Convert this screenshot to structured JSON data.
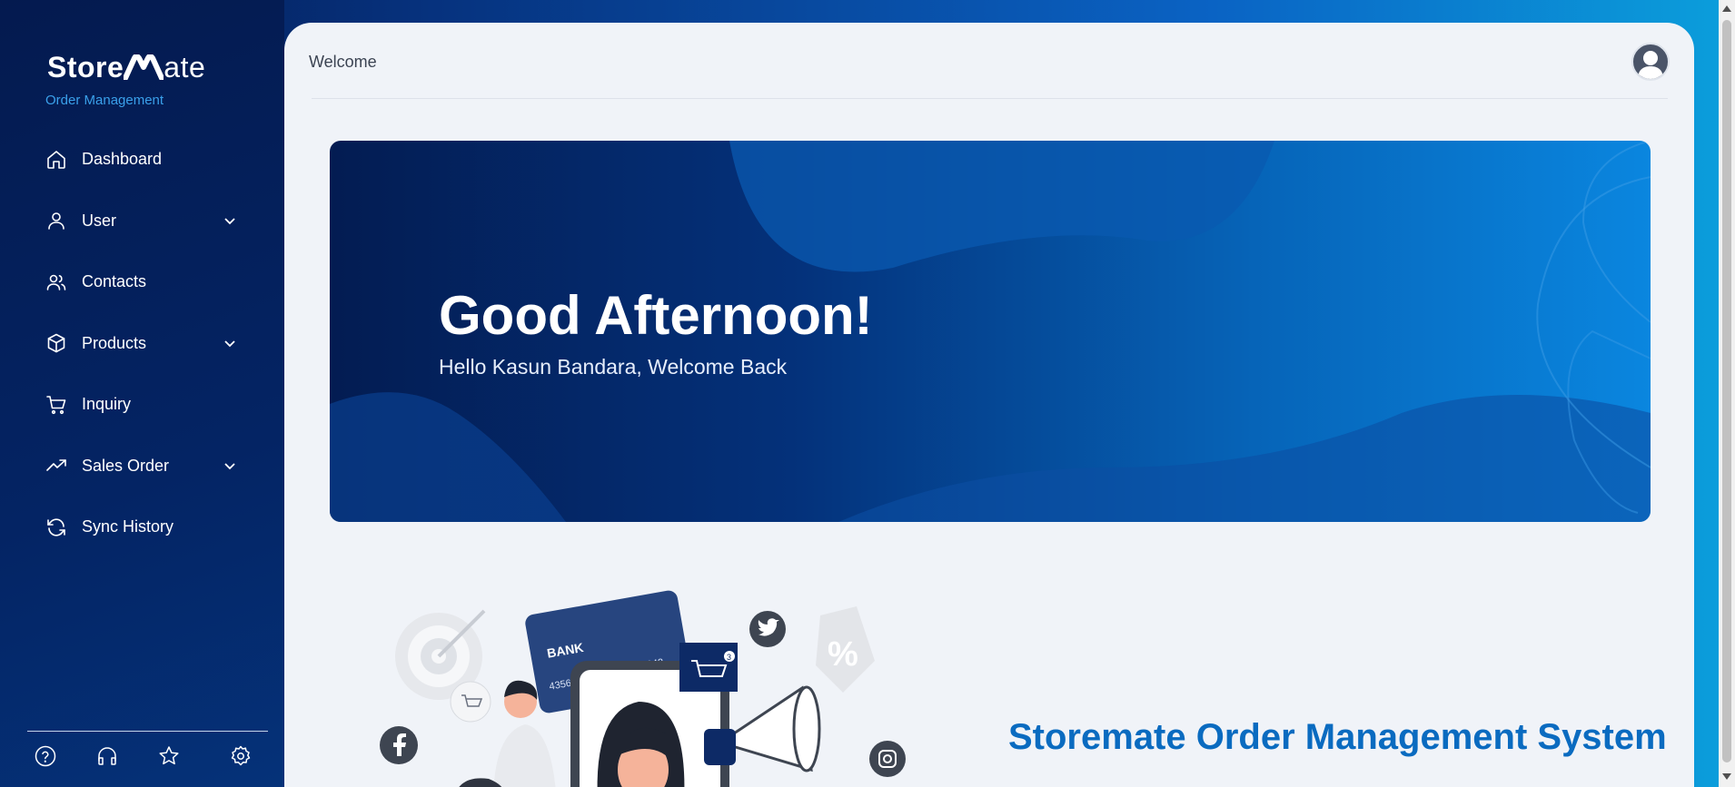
{
  "sidebar": {
    "logo_bold": "Store",
    "logo_light": "ate",
    "logo_subtitle": "Order Management",
    "items": [
      {
        "label": "Dashboard",
        "icon": "home-icon"
      },
      {
        "label": "User",
        "icon": "user-icon",
        "expandable": true
      },
      {
        "label": "Contacts",
        "icon": "users-icon"
      },
      {
        "label": "Products",
        "icon": "box-icon",
        "expandable": true
      },
      {
        "label": "Inquiry",
        "icon": "cart-icon"
      },
      {
        "label": "Sales Order",
        "icon": "trending-up-icon",
        "expandable": true
      },
      {
        "label": "Sync History",
        "icon": "refresh-icon"
      }
    ],
    "bottom_icons": [
      "help-icon",
      "headphones-icon",
      "star-icon",
      "settings-icon"
    ]
  },
  "header": {
    "title": "Welcome"
  },
  "hero": {
    "greeting": "Good Afternoon!",
    "message": "Hello Kasun Bandara, Welcome Back"
  },
  "illustration": {
    "bank_label": "BANK",
    "card_number_left": "4356",
    "card_number_right": "1342",
    "percent": "%",
    "cart_badge": "3"
  },
  "footer_title": "Storemate Order Management System",
  "colors": {
    "accent": "#0a6bc0",
    "sidebar": "#041a4f",
    "panel": "#f0f3f8"
  }
}
